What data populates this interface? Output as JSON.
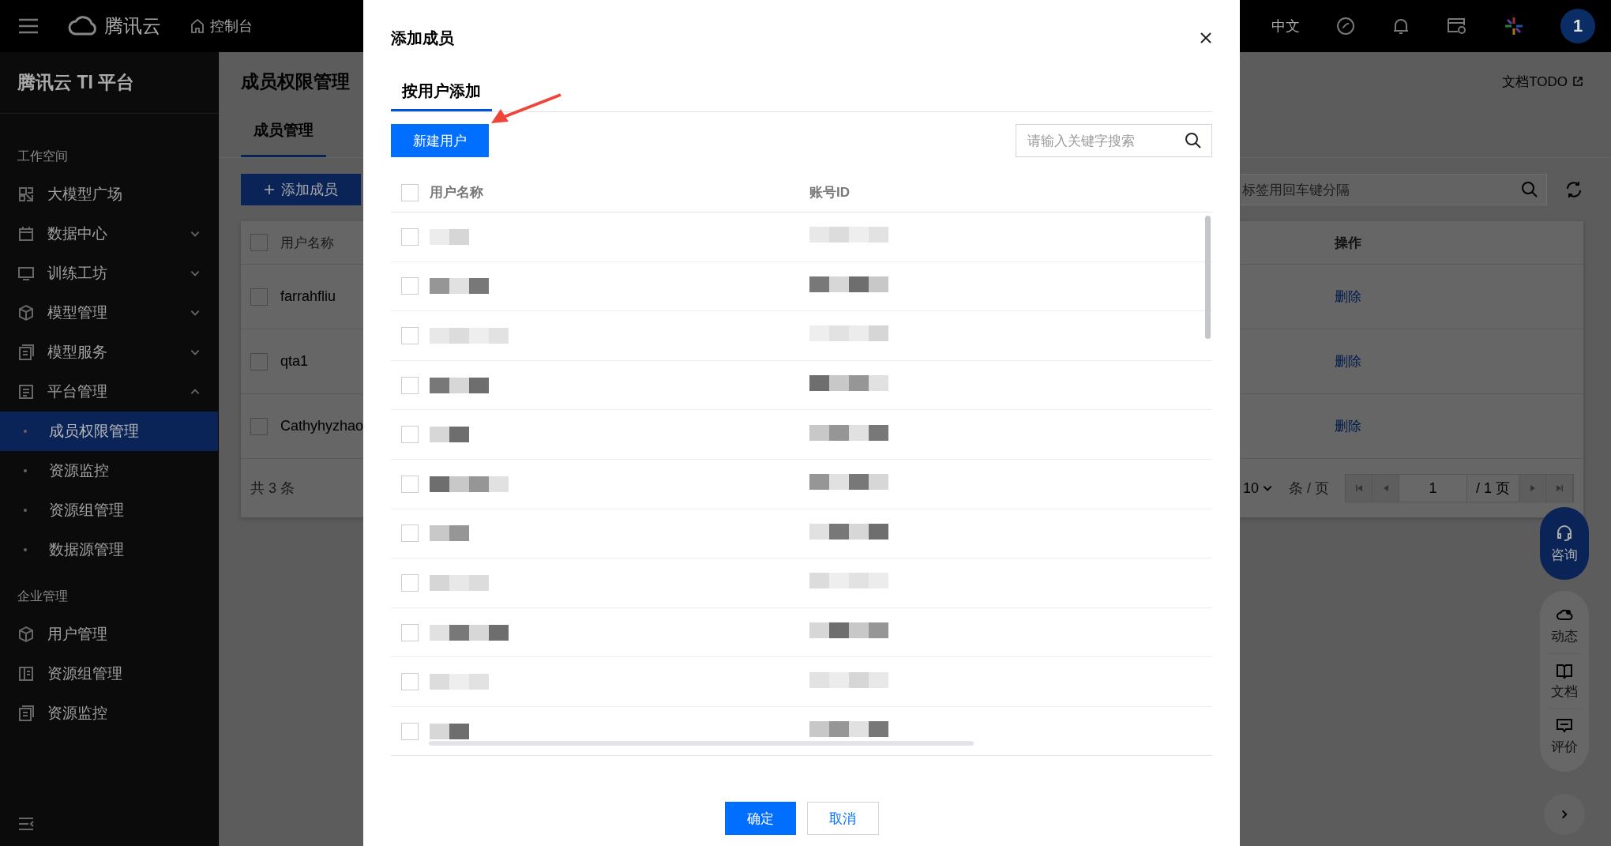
{
  "topbar": {
    "logo": "腾讯云",
    "console": "控制台",
    "language": "中文",
    "avatar": "1"
  },
  "sidebar": {
    "title": "腾讯云 TI 平台",
    "groups": [
      {
        "heading": "工作空间",
        "items": [
          {
            "label": "大模型广场",
            "selected": false
          },
          {
            "label": "数据中心",
            "selected": false,
            "expanded": false
          },
          {
            "label": "训练工坊",
            "selected": false,
            "expanded": false
          },
          {
            "label": "模型管理",
            "selected": false,
            "expanded": false
          },
          {
            "label": "模型服务",
            "selected": false,
            "expanded": false
          },
          {
            "label": "平台管理",
            "selected": false,
            "expanded": true,
            "children": [
              {
                "label": "成员权限管理",
                "selected": true
              },
              {
                "label": "资源监控",
                "selected": false
              },
              {
                "label": "资源组管理",
                "selected": false
              },
              {
                "label": "数据源管理",
                "selected": false
              }
            ]
          }
        ]
      },
      {
        "heading": "企业管理",
        "items": [
          {
            "label": "用户管理",
            "selected": false
          },
          {
            "label": "资源组管理",
            "selected": false
          },
          {
            "label": "资源监控",
            "selected": false
          }
        ]
      }
    ]
  },
  "page": {
    "title": "成员权限管理",
    "doc_link": "文档TODO",
    "tabs": [
      {
        "label": "成员管理",
        "selected": true
      }
    ],
    "add_button": "添加成员",
    "search": {
      "placeholder": "标签用回车键分隔"
    },
    "table": {
      "all_checked": false,
      "columns": [
        "用户名称",
        "操作"
      ],
      "rows": [
        {
          "name": "farrahfliu",
          "checked": false,
          "action": "删除"
        },
        {
          "name": "qta1",
          "checked": false,
          "action": "删除"
        },
        {
          "name": "Cathyhyzhao",
          "checked": false,
          "action": "删除"
        }
      ]
    },
    "total": "共 3 条",
    "page_size": "10",
    "page_size_unit": "条 / 页",
    "page": "1",
    "page_total": "/ 1 页"
  },
  "float_tools": {
    "consult": "咨询",
    "items": [
      "动态",
      "文档",
      "评价"
    ]
  },
  "modal": {
    "title": "添加成员",
    "tabs": [
      {
        "label": "按用户添加",
        "selected": true
      }
    ],
    "new_user_button": "新建用户",
    "search": {
      "placeholder": "请输入关键字搜索"
    },
    "all_checked": false,
    "columns": [
      "用户名称",
      "账号ID"
    ],
    "rows": [
      {
        "checked": false
      },
      {
        "checked": false
      },
      {
        "checked": false
      },
      {
        "checked": false
      },
      {
        "checked": false
      },
      {
        "checked": false
      },
      {
        "checked": false
      },
      {
        "checked": false
      },
      {
        "checked": false
      },
      {
        "checked": false
      },
      {
        "checked": false
      }
    ],
    "buttons": [
      "确定",
      "取消"
    ]
  }
}
